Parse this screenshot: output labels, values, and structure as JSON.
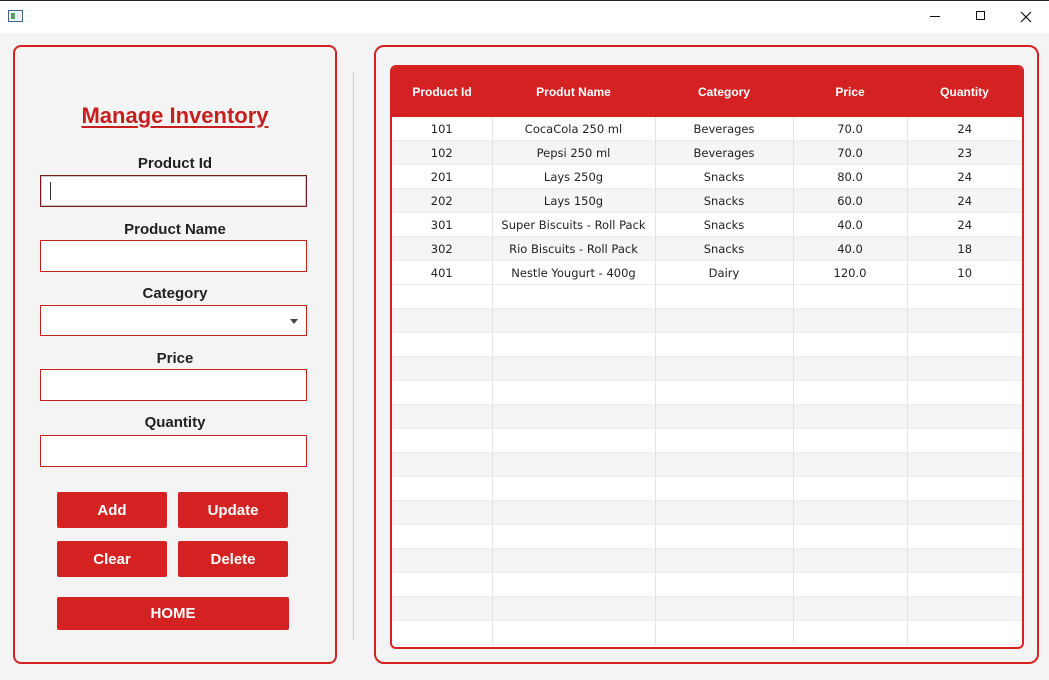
{
  "form": {
    "title": "Manage Inventory",
    "product_id_label": "Product Id",
    "product_id_value": "",
    "product_name_label": "Product Name",
    "product_name_value": "",
    "category_label": "Category",
    "category_value": "",
    "price_label": "Price",
    "price_value": "",
    "quantity_label": "Quantity",
    "quantity_value": ""
  },
  "buttons": {
    "add": "Add",
    "update": "Update",
    "clear": "Clear",
    "delete": "Delete",
    "home": "HOME"
  },
  "table": {
    "headers": [
      "Product Id",
      "Produt Name",
      "Category",
      "Price",
      "Quantity"
    ],
    "rows": [
      [
        "101",
        "CocaCola 250 ml",
        "Beverages",
        "70.0",
        "24"
      ],
      [
        "102",
        "Pepsi 250 ml",
        "Beverages",
        "70.0",
        "23"
      ],
      [
        "201",
        "Lays 250g",
        "Snacks",
        "80.0",
        "24"
      ],
      [
        "202",
        "Lays 150g",
        "Snacks",
        "60.0",
        "24"
      ],
      [
        "301",
        "Super Biscuits - Roll Pack",
        "Snacks",
        "40.0",
        "24"
      ],
      [
        "302",
        "Rio Biscuits - Roll Pack",
        "Snacks",
        "40.0",
        "18"
      ],
      [
        "401",
        "Nestle Yougurt - 400g",
        "Dairy",
        "120.0",
        "10"
      ]
    ]
  },
  "colors": {
    "accent": "#d42222"
  }
}
